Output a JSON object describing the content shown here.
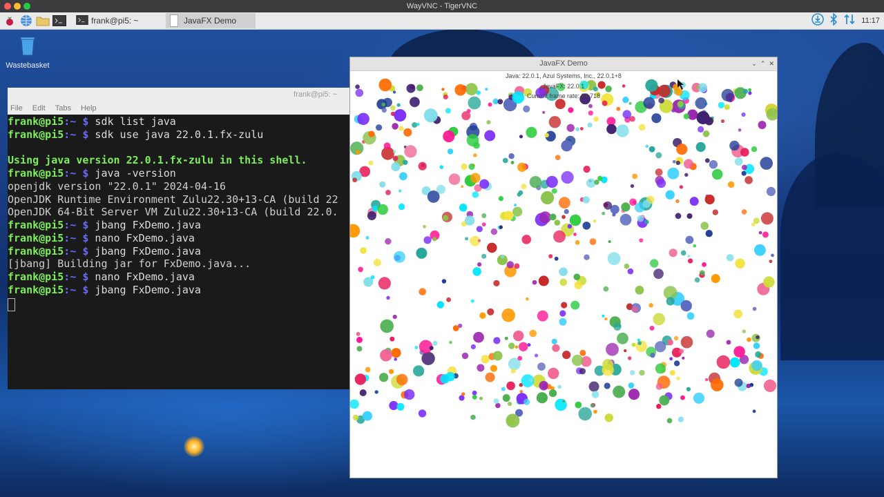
{
  "host": {
    "title": "WayVNC - TigerVNC"
  },
  "taskbar": {
    "tasks": [
      {
        "label": "frank@pi5: ~"
      },
      {
        "label": "JavaFX Demo"
      }
    ],
    "clock": "11:17",
    "icons": [
      "raspberry-menu-icon",
      "browser-globe-icon",
      "file-manager-folder-icon",
      "terminal-icon",
      "download-icon",
      "bluetooth-icon",
      "network-arrows-icon"
    ]
  },
  "desktop": {
    "wastebasket_label": "Wastebasket"
  },
  "terminal": {
    "title": "frank@pi5: ~",
    "menu": [
      "File",
      "Edit",
      "Tabs",
      "Help"
    ],
    "prompt_user": "frank@pi5",
    "prompt_path": ":~ $",
    "lines": [
      {
        "kind": "cmd",
        "text": " sdk list java"
      },
      {
        "kind": "cmd",
        "text": " sdk use java 22.0.1.fx-zulu"
      },
      {
        "kind": "blank",
        "text": ""
      },
      {
        "kind": "info",
        "text": "Using java version 22.0.1.fx-zulu in this shell."
      },
      {
        "kind": "cmd",
        "text": " java -version"
      },
      {
        "kind": "out",
        "text": "openjdk version \"22.0.1\" 2024-04-16"
      },
      {
        "kind": "out",
        "text": "OpenJDK Runtime Environment Zulu22.30+13-CA (build 22"
      },
      {
        "kind": "out",
        "text": "OpenJDK 64-Bit Server VM Zulu22.30+13-CA (build 22.0."
      },
      {
        "kind": "cmd",
        "text": " jbang FxDemo.java"
      },
      {
        "kind": "cmd",
        "text": " nano FxDemo.java"
      },
      {
        "kind": "cmd",
        "text": " jbang FxDemo.java"
      },
      {
        "kind": "out",
        "text": "[jbang] Building jar for FxDemo.java..."
      },
      {
        "kind": "cmd",
        "text": " nano FxDemo.java"
      },
      {
        "kind": "cmd",
        "text": " jbang FxDemo.java"
      }
    ]
  },
  "fx_window": {
    "title": "JavaFX Demo",
    "info_line1": "Java: 22.0.1, Azul Systems, Inc., 22.0.1+8",
    "info_line2": "JavaFX: 22.0.1",
    "info_line3": "Current frame rate: 24.718",
    "ball_colors": [
      "#e81e5a",
      "#7b2ff7",
      "#2ecc40",
      "#39d0ff",
      "#f4e342",
      "#ff6a00",
      "#f06292",
      "#9c27b0",
      "#1e3c96",
      "#4caf50",
      "#00e5ff",
      "#ff1493",
      "#8bc34a",
      "#c62828",
      "#5c6bc0",
      "#80deea",
      "#cddc39",
      "#3f1f6e",
      "#ff9800",
      "#26a69a"
    ]
  }
}
